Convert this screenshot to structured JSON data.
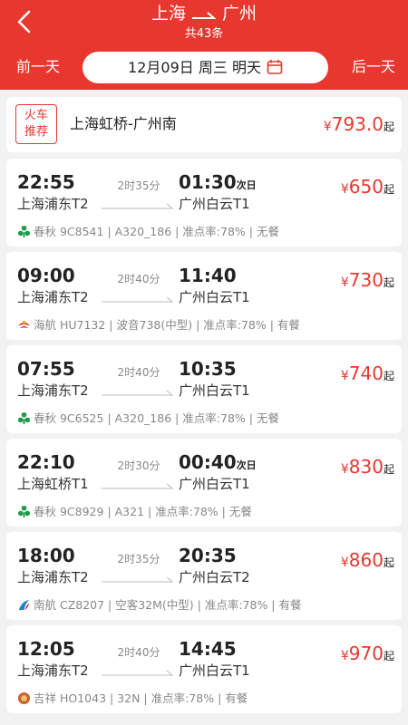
{
  "header": {
    "from": "上海",
    "to": "广州",
    "count": "共43条",
    "prev_day": "前一天",
    "next_day": "后一天",
    "date": "12月09日 周三 明天"
  },
  "colors": {
    "brand": "#e8372f"
  },
  "train": {
    "badge_line1": "火车",
    "badge_line2": "推荐",
    "route": "上海虹桥-广州南",
    "currency": "¥",
    "price": "793.0",
    "suffix": "起"
  },
  "flights": [
    {
      "dep_time": "22:55",
      "dep_airport": "上海浦东T2",
      "duration": "2时35分",
      "arr_time": "01:30",
      "next_day": "次日",
      "arr_airport": "广州白云T1",
      "currency": "¥",
      "price": "650",
      "suffix": "起",
      "info": "春秋 9C8541 | A320_186 | 准点率:78% | 无餐",
      "logo": "spring-airlines-logo"
    },
    {
      "dep_time": "09:00",
      "dep_airport": "上海浦东T2",
      "duration": "2时40分",
      "arr_time": "11:40",
      "next_day": "",
      "arr_airport": "广州白云T1",
      "currency": "¥",
      "price": "730",
      "suffix": "起",
      "info": "海航 HU7132 | 波音738(中型) | 准点率:78% | 有餐",
      "logo": "hainan-airlines-logo"
    },
    {
      "dep_time": "07:55",
      "dep_airport": "上海浦东T2",
      "duration": "2时40分",
      "arr_time": "10:35",
      "next_day": "",
      "arr_airport": "广州白云T1",
      "currency": "¥",
      "price": "740",
      "suffix": "起",
      "info": "春秋 9C6525 | A320_186 | 准点率:78% | 无餐",
      "logo": "spring-airlines-logo"
    },
    {
      "dep_time": "22:10",
      "dep_airport": "上海虹桥T1",
      "duration": "2时30分",
      "arr_time": "00:40",
      "next_day": "次日",
      "arr_airport": "广州白云T1",
      "currency": "¥",
      "price": "830",
      "suffix": "起",
      "info": "春秋 9C8929 | A321 | 准点率:78% | 无餐",
      "logo": "spring-airlines-logo"
    },
    {
      "dep_time": "18:00",
      "dep_airport": "上海浦东T2",
      "duration": "2时35分",
      "arr_time": "20:35",
      "next_day": "",
      "arr_airport": "广州白云T2",
      "currency": "¥",
      "price": "860",
      "suffix": "起",
      "info": "南航 CZ8207 | 空客32M(中型) | 准点率:78% | 有餐",
      "logo": "china-southern-logo"
    },
    {
      "dep_time": "12:05",
      "dep_airport": "上海浦东T2",
      "duration": "2时40分",
      "arr_time": "14:45",
      "next_day": "",
      "arr_airport": "广州白云T1",
      "currency": "¥",
      "price": "970",
      "suffix": "起",
      "info": "吉祥 HO1043 | 32N | 准点率:78% | 有餐",
      "logo": "juneyao-airlines-logo"
    }
  ]
}
